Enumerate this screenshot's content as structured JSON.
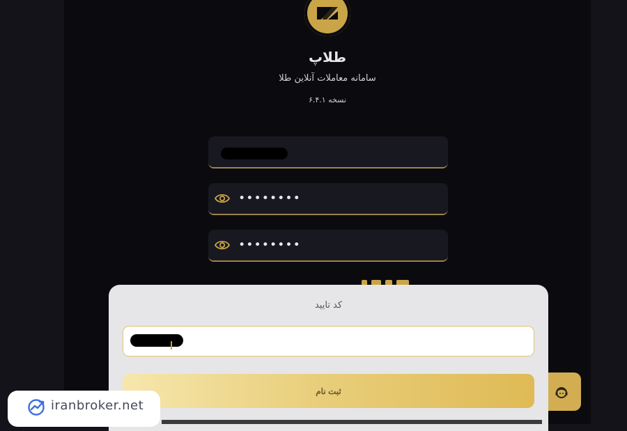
{
  "brand": {
    "name": "طلاپ",
    "subtitle": "سامانه معاملات آنلاین طلا",
    "version": "نسخه ۶.۴.۱"
  },
  "form": {
    "username_value": "",
    "password_mask": "••••••••",
    "confirm_password_mask": "••••••••"
  },
  "sheet": {
    "title": "کد تایید",
    "code_value": "",
    "submit_label": "ثبت نام"
  },
  "watermark": {
    "text": "iranbroker.net"
  },
  "icons": {
    "logo": "brand-logo",
    "eye": "eye-icon",
    "support": "support-headset-icon",
    "watermark": "chart-trend-icon"
  },
  "colors": {
    "background": "#0b0b0f",
    "gold": "#c9a547",
    "field": "#181820",
    "sheet": "#e6e6e8"
  }
}
